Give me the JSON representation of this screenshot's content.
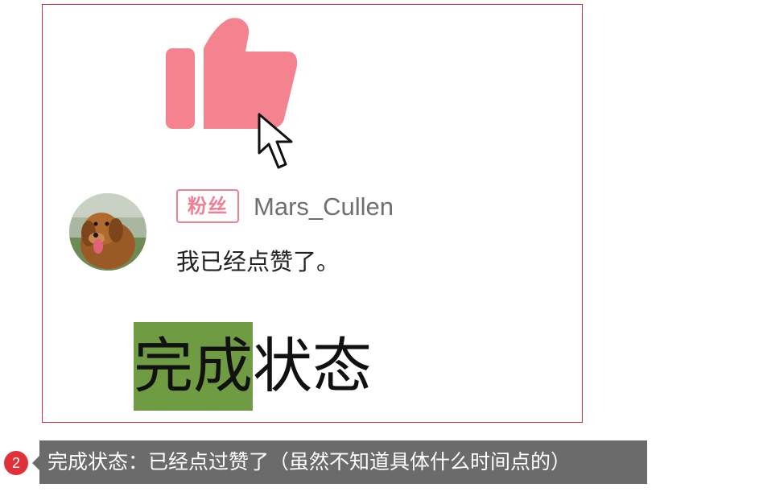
{
  "illustration": {
    "like_icon": "thumbs-up-icon",
    "like_color": "#f4838f",
    "cursor_icon": "cursor-arrow-icon"
  },
  "comment_card": {
    "avatar": "dog-avatar",
    "fan_badge": "粉丝",
    "username": "Mars_Cullen",
    "text": "我已经点赞了。"
  },
  "state_label": {
    "highlighted": "完成",
    "rest": "状态",
    "highlight_color": "#6f9c42"
  },
  "caption": {
    "number": "2",
    "text": "完成状态：已经点过赞了（虽然不知道具体什么时间点的）"
  }
}
